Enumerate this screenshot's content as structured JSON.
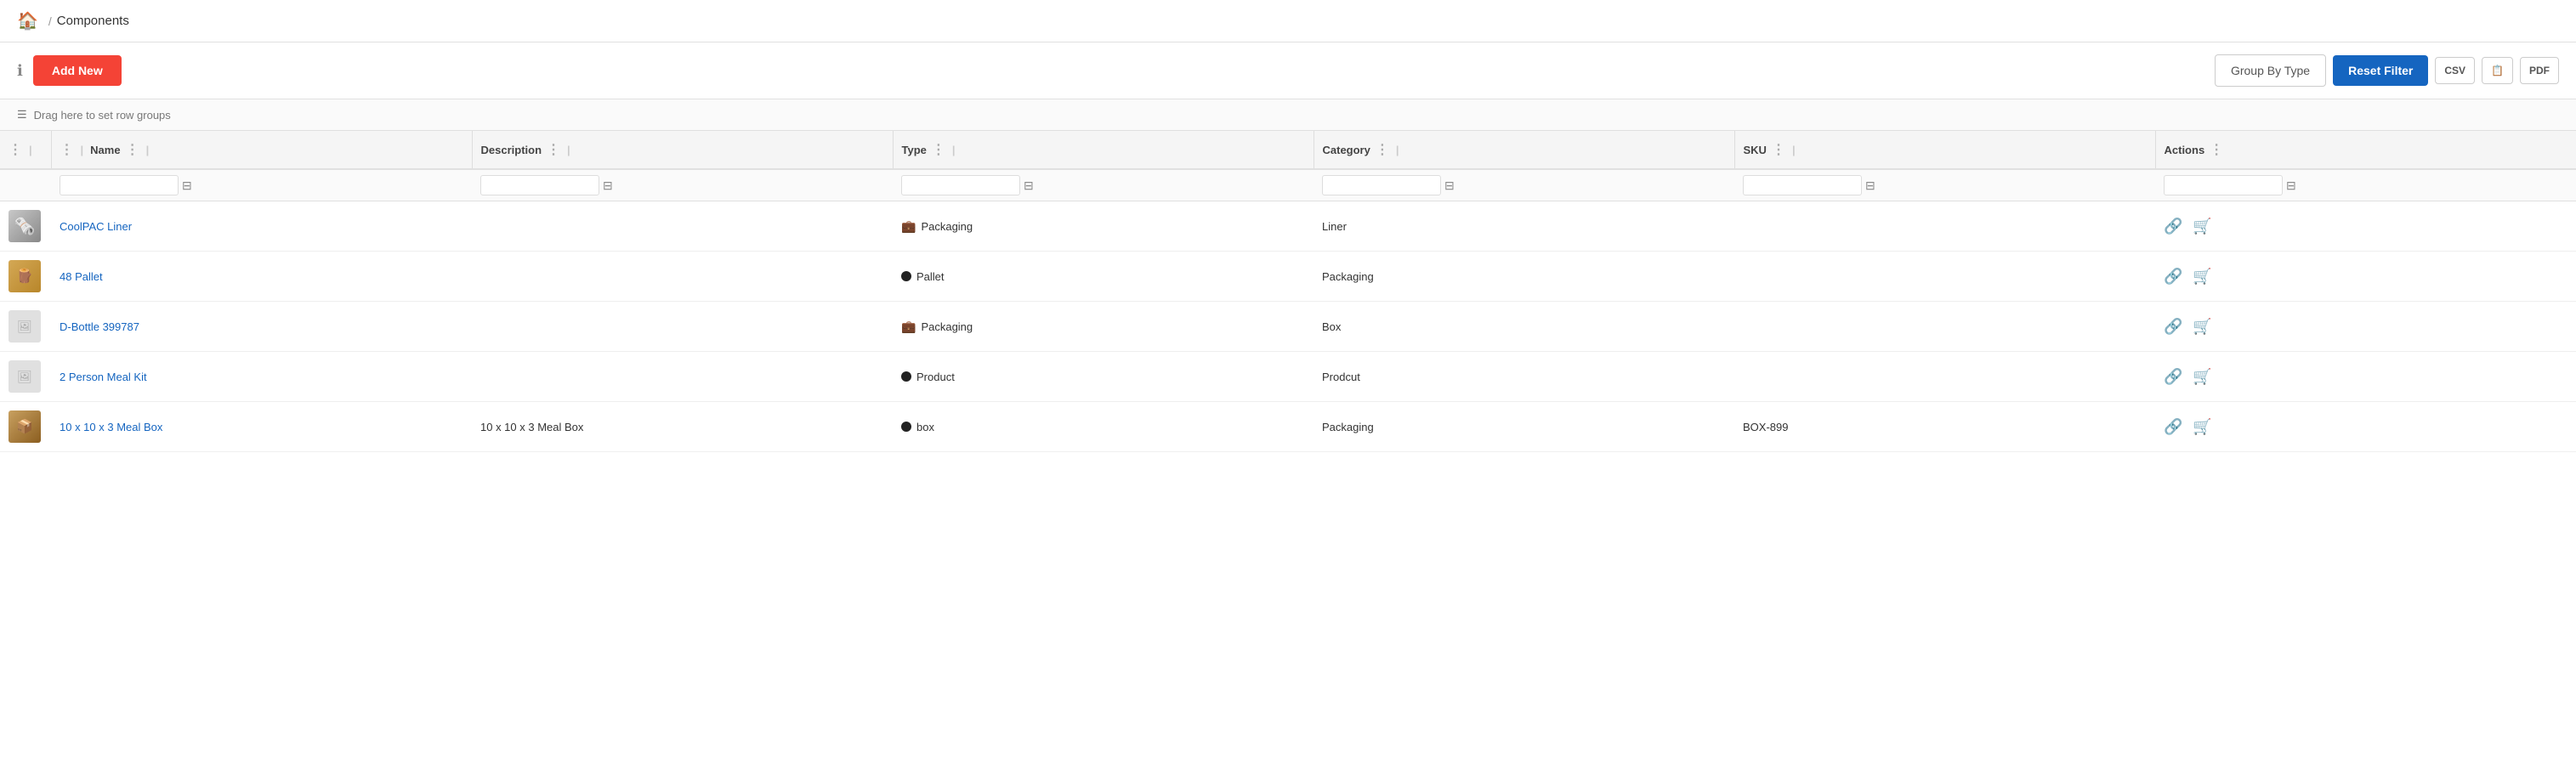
{
  "breadcrumb": {
    "home_icon": "🏠",
    "separator": "/",
    "page": "Components"
  },
  "toolbar": {
    "info_icon": "ℹ",
    "add_new_label": "Add New",
    "group_by_type_label": "Group By Type",
    "reset_filter_label": "Reset Filter",
    "export_csv_label": "CSV",
    "export_doc_label": "📄",
    "export_pdf_label": "PDF"
  },
  "drag_row": {
    "icon": "☰",
    "text": "Drag here to set row groups"
  },
  "table": {
    "columns": [
      {
        "id": "name",
        "label": "Name"
      },
      {
        "id": "description",
        "label": "Description"
      },
      {
        "id": "type",
        "label": "Type"
      },
      {
        "id": "category",
        "label": "Category"
      },
      {
        "id": "sku",
        "label": "SKU"
      },
      {
        "id": "actions",
        "label": "Actions"
      }
    ],
    "rows": [
      {
        "thumb": "coolpac",
        "name": "CoolPAC Liner",
        "description": "",
        "type": "Packaging",
        "type_icon": "briefcase",
        "category": "Liner",
        "sku": "",
        "id": 1
      },
      {
        "thumb": "pallet",
        "name": "48 Pallet",
        "description": "",
        "type": "Pallet",
        "type_icon": "dot",
        "category": "Packaging",
        "sku": "",
        "id": 2
      },
      {
        "thumb": "image",
        "name": "D-Bottle 399787",
        "description": "",
        "type": "Packaging",
        "type_icon": "briefcase",
        "category": "Box",
        "sku": "",
        "id": 3
      },
      {
        "thumb": "image",
        "name": "2 Person Meal Kit",
        "description": "",
        "type": "Product",
        "type_icon": "dot",
        "category": "Prodcut",
        "sku": "",
        "id": 4
      },
      {
        "thumb": "mealbox",
        "name": "10 x 10 x 3 Meal Box",
        "description": "10 x 10 x 3 Meal Box",
        "type": "box",
        "type_icon": "dot",
        "category": "Packaging",
        "sku": "BOX-899",
        "id": 5
      }
    ]
  }
}
